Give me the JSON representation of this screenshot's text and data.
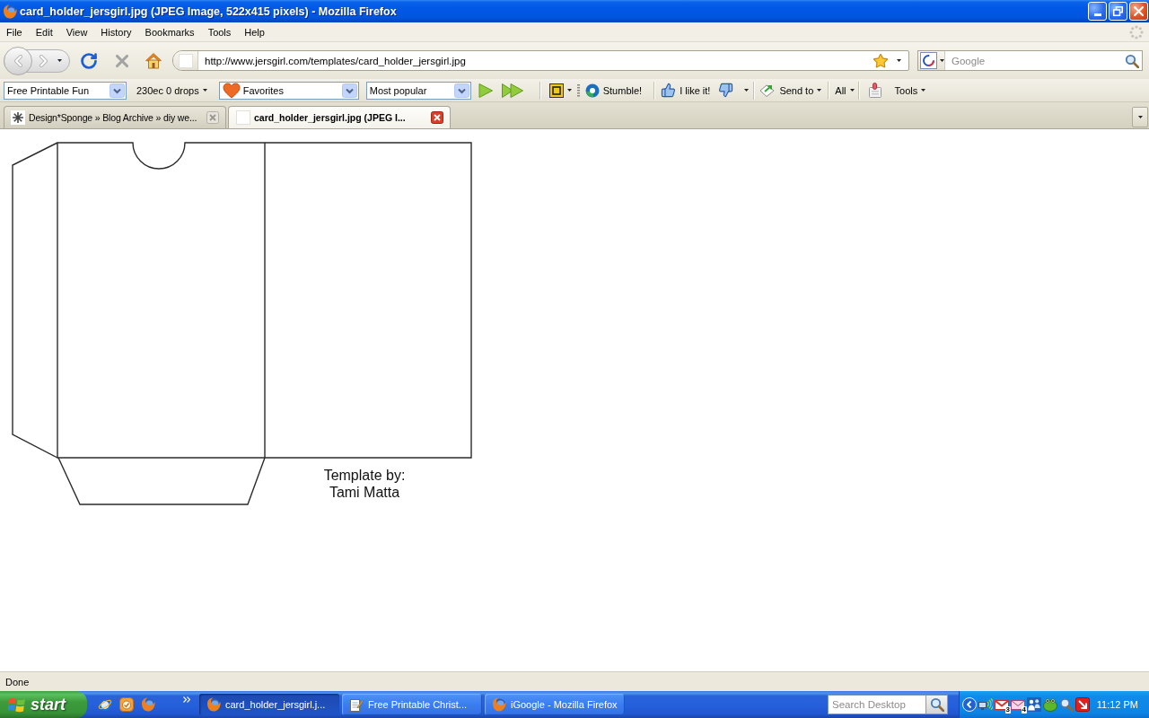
{
  "window": {
    "title": "card_holder_jersgirl.jpg (JPEG Image, 522x415 pixels) - Mozilla Firefox"
  },
  "menu_bar": [
    "File",
    "Edit",
    "View",
    "History",
    "Bookmarks",
    "Tools",
    "Help"
  ],
  "navigation": {
    "back": {
      "disabled": true
    },
    "forward": {
      "disabled": true
    },
    "stop": {
      "disabled": true
    },
    "url": "http://www.jersgirl.com/templates/card_holder_jersgirl.jpg"
  },
  "search": {
    "placeholder": "Google"
  },
  "toolbar": {
    "group_select": "Free Printable Fun",
    "drops_menu": "230ec 0 drops",
    "favorites_select": "Favorites",
    "popular_select": "Most popular",
    "stumble_button": "Stumble!",
    "like_button": "I like it!",
    "send_menu": "Send to",
    "all_menu": "All",
    "tools_menu": "Tools"
  },
  "tabs": [
    {
      "label": "Design*Sponge » Blog Archive » diy we...",
      "kind": "page",
      "selected": false
    },
    {
      "label": "card_holder_jersgirl.jpg (JPEG I...",
      "kind": "image",
      "selected": true
    }
  ],
  "page": {
    "caption_lines": [
      "Template by:",
      "Tami Matta"
    ]
  },
  "status_bar": {
    "text": "Done"
  },
  "taskbar": {
    "start_label": "start",
    "tasks": [
      {
        "label": "card_holder_jersgirl.j...",
        "kind": "browser",
        "selected": true
      },
      {
        "label": "Free Printable Christ...",
        "kind": "document",
        "selected": false
      },
      {
        "label": "iGoogle - Mozilla Firefox",
        "kind": "browser",
        "selected": false
      }
    ],
    "desktop_search": {
      "placeholder": "Search Desktop"
    },
    "tray": {
      "unread_mail": "3",
      "new_mail": "4"
    },
    "clock": "11:12 PM"
  }
}
